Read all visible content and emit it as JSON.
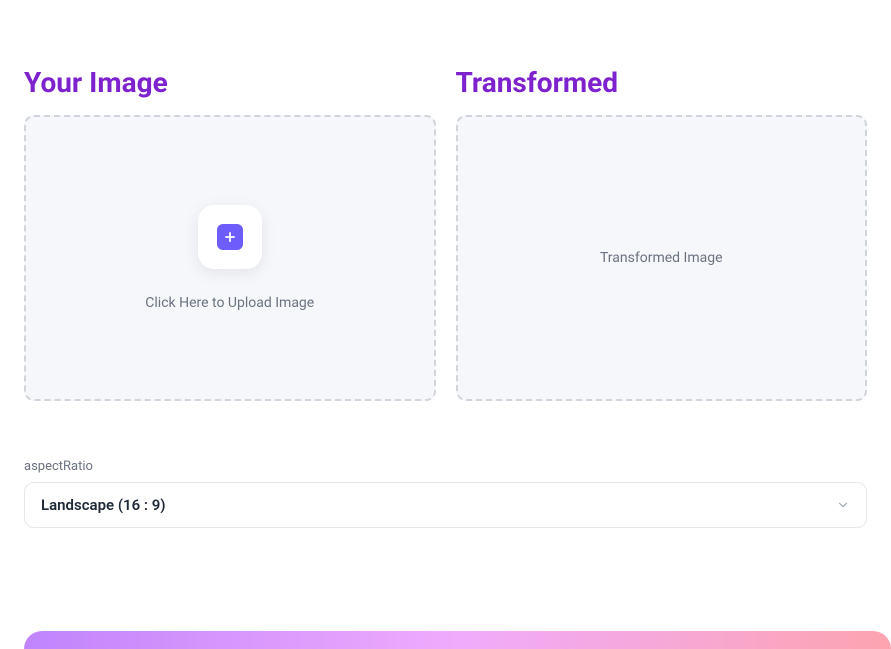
{
  "panels": {
    "source": {
      "title": "Your Image",
      "uploadPrompt": "Click Here to Upload Image"
    },
    "output": {
      "title": "Transformed",
      "placeholder": "Transformed Image"
    }
  },
  "form": {
    "aspectRatio": {
      "label": "aspectRatio",
      "selected": "Landscape (16 : 9)"
    }
  }
}
